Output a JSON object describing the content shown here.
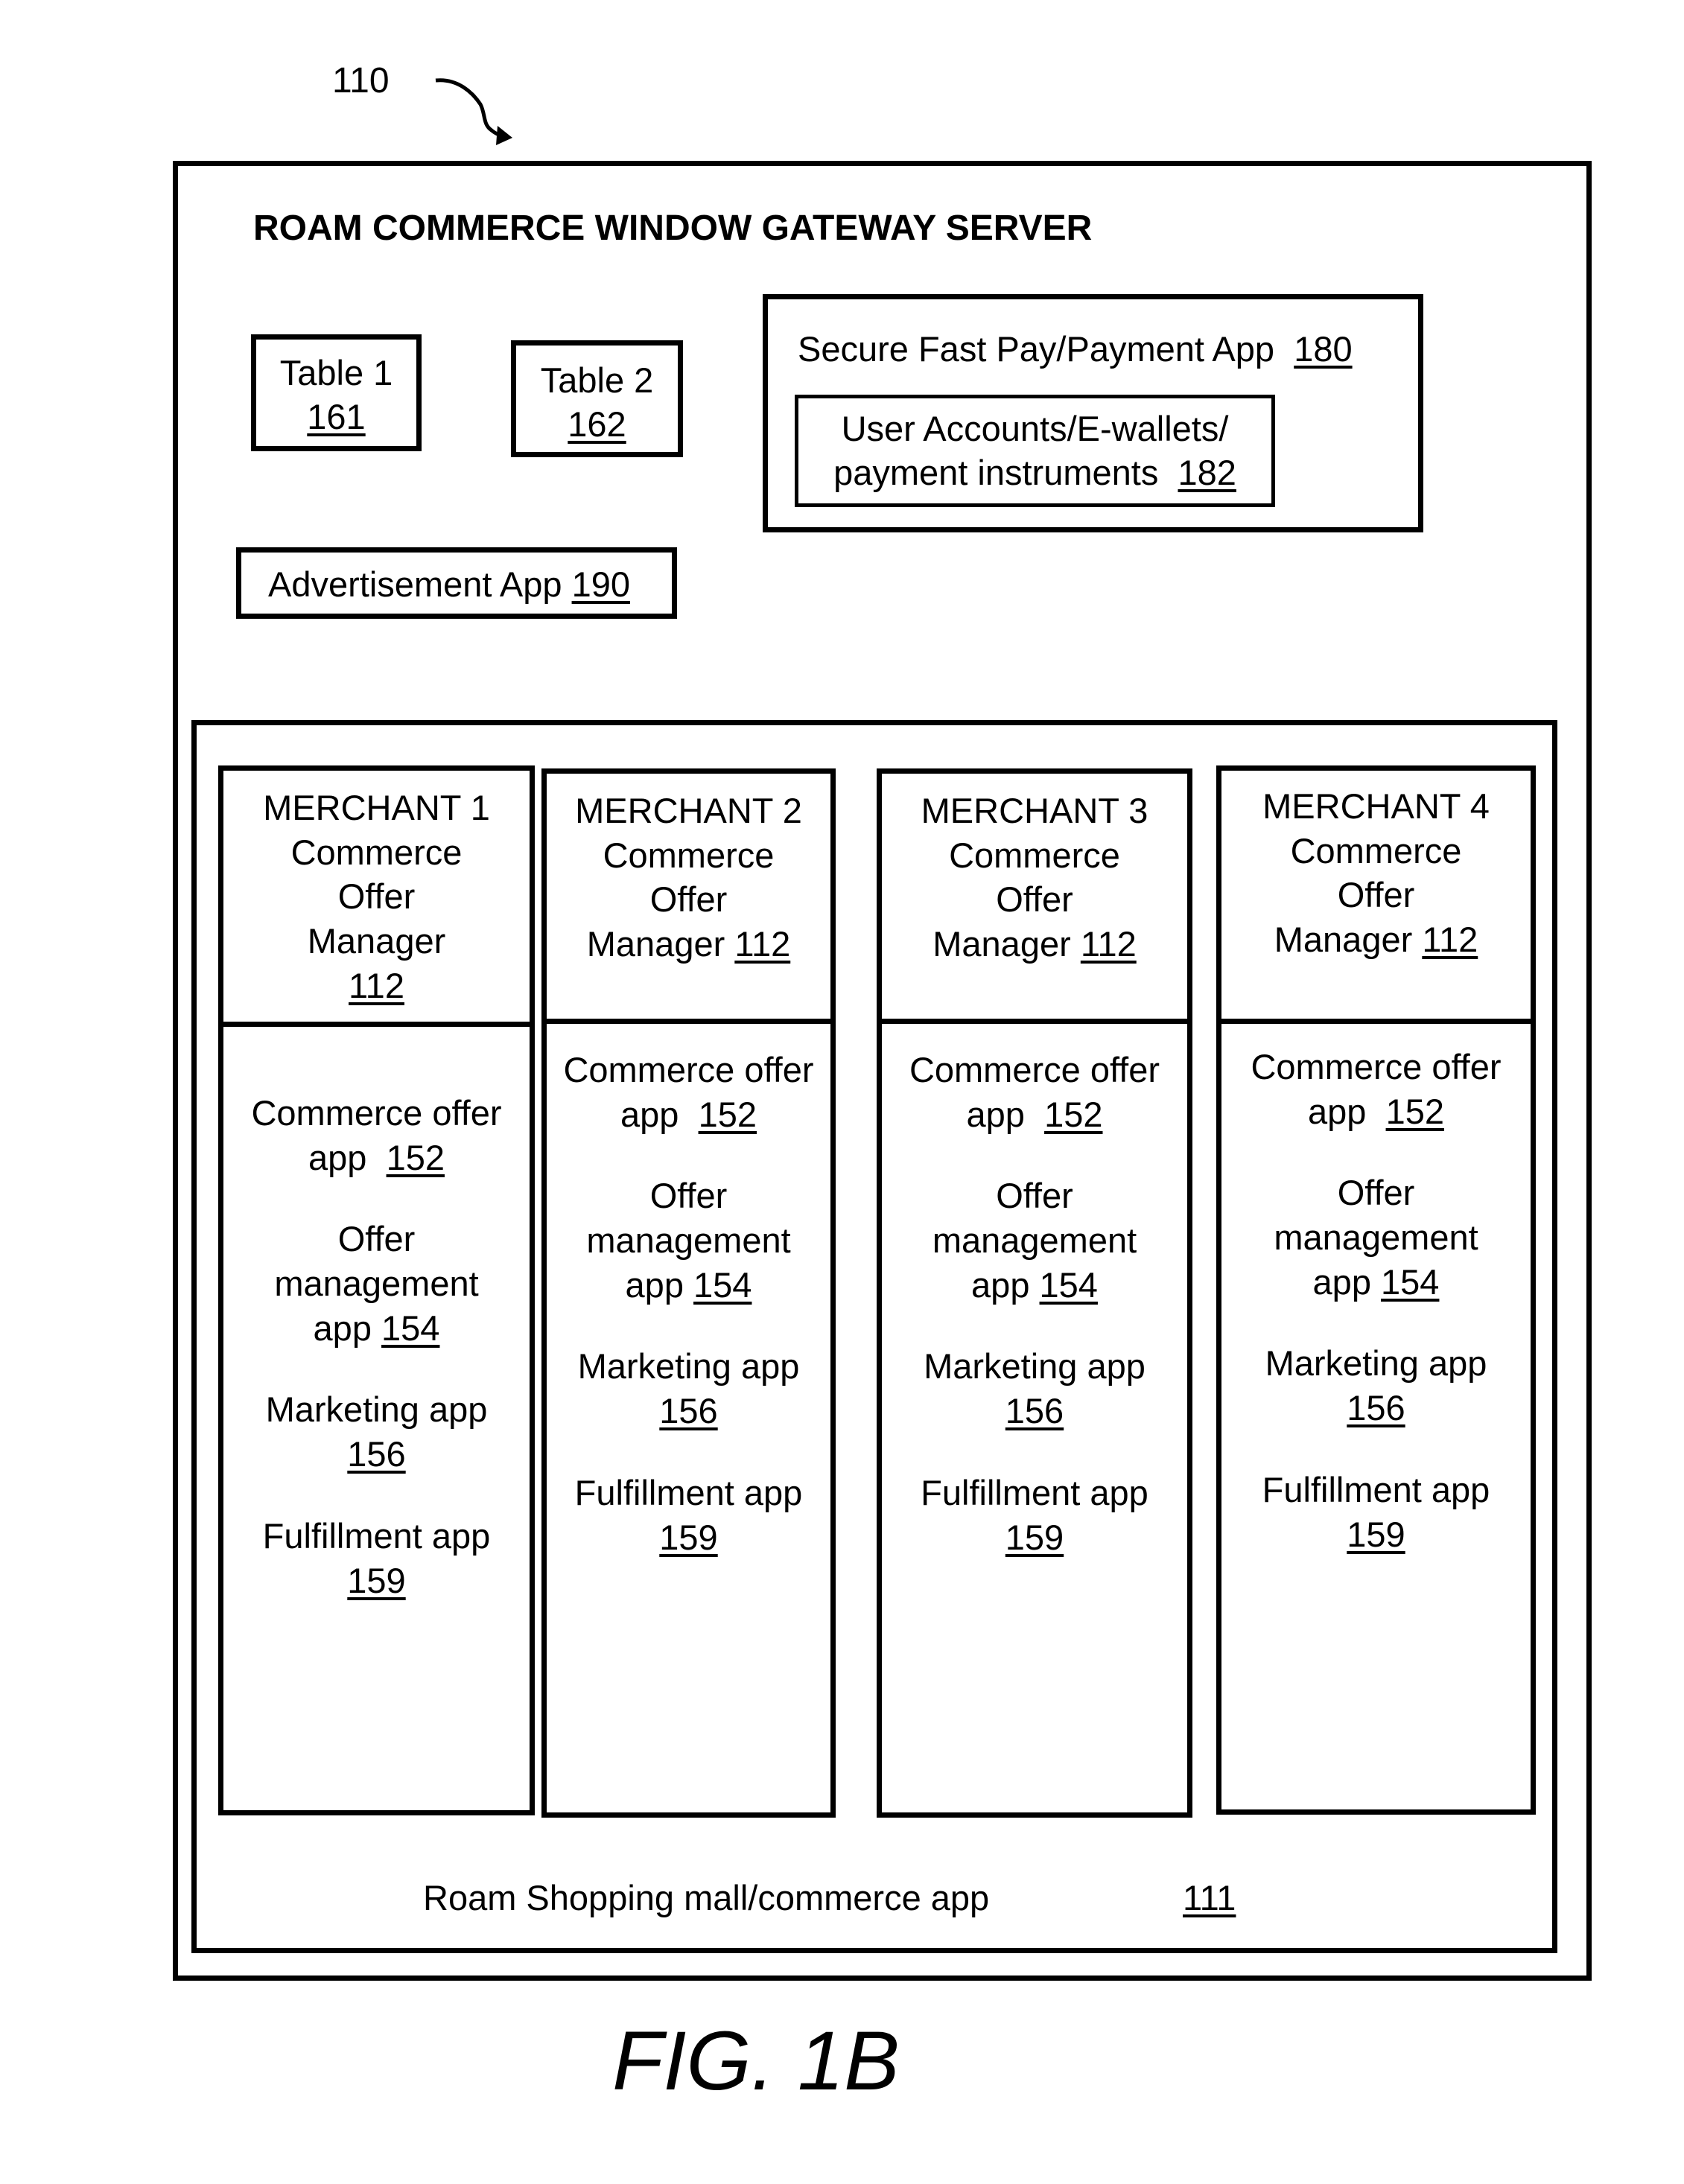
{
  "figure": {
    "reference_label": "110",
    "caption": "FIG. 1B"
  },
  "server": {
    "title": "ROAM COMMERCE WINDOW GATEWAY SERVER",
    "table1": {
      "label": "Table 1",
      "ref": "161"
    },
    "table2": {
      "label": "Table 2",
      "ref": "162"
    },
    "payment_app": {
      "label": "Secure Fast Pay/Payment App",
      "ref": "180"
    },
    "user_accounts": {
      "line1": "User Accounts/E-wallets/",
      "line2": "payment instruments",
      "ref": "182"
    },
    "advertisement_app": {
      "label": "Advertisement App",
      "ref": "190"
    }
  },
  "mall": {
    "label": "Roam Shopping mall/commerce app",
    "ref": "111",
    "merchants": [
      {
        "name": "MERCHANT 1",
        "manager_lines": [
          "Commerce",
          "Offer",
          "Manager"
        ],
        "manager_ref": "112",
        "apps": [
          {
            "line1": "Commerce offer",
            "line2": "app",
            "ref": "152"
          },
          {
            "line1": "Offer",
            "line2": "management",
            "line3": "app",
            "ref": "154"
          },
          {
            "line1": "Marketing app",
            "ref": "156"
          },
          {
            "line1": "Fulfillment app",
            "ref": "159"
          }
        ]
      },
      {
        "name": "MERCHANT 2",
        "manager_lines": [
          "Commerce",
          "Offer",
          "Manager"
        ],
        "manager_ref": "112",
        "apps": [
          {
            "line1": "Commerce offer",
            "line2": "app",
            "ref": "152"
          },
          {
            "line1": "Offer",
            "line2": "management",
            "line3": "app",
            "ref": "154"
          },
          {
            "line1": "Marketing app",
            "ref": "156"
          },
          {
            "line1": "Fulfillment app",
            "ref": "159"
          }
        ]
      },
      {
        "name": "MERCHANT 3",
        "manager_lines": [
          "Commerce",
          "Offer",
          "Manager"
        ],
        "manager_ref": "112",
        "apps": [
          {
            "line1": "Commerce offer",
            "line2": "app",
            "ref": "152"
          },
          {
            "line1": "Offer",
            "line2": "management",
            "line3": "app",
            "ref": "154"
          },
          {
            "line1": "Marketing app",
            "ref": "156"
          },
          {
            "line1": "Fulfillment app",
            "ref": "159"
          }
        ]
      },
      {
        "name": "MERCHANT 4",
        "manager_lines": [
          "Commerce",
          "Offer",
          "Manager"
        ],
        "manager_ref": "112",
        "apps": [
          {
            "line1": "Commerce offer",
            "line2": "app",
            "ref": "152"
          },
          {
            "line1": "Offer",
            "line2": "management",
            "line3": "app",
            "ref": "154"
          },
          {
            "line1": "Marketing app",
            "ref": "156"
          },
          {
            "line1": "Fulfillment app",
            "ref": "159"
          }
        ]
      }
    ]
  }
}
